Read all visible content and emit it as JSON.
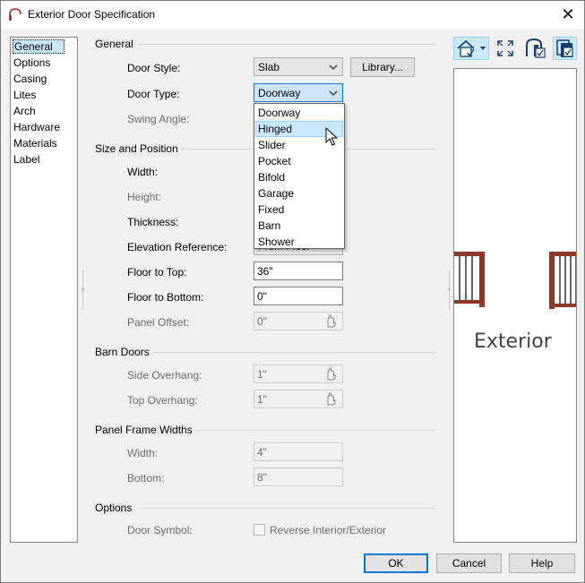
{
  "window": {
    "title": "Exterior Door Specification",
    "close_glyph": "✕"
  },
  "sidebar": {
    "items": [
      {
        "label": "General",
        "selected": true
      },
      {
        "label": "Options"
      },
      {
        "label": "Casing"
      },
      {
        "label": "Lites"
      },
      {
        "label": "Arch"
      },
      {
        "label": "Hardware"
      },
      {
        "label": "Materials"
      },
      {
        "label": "Label"
      }
    ]
  },
  "general": {
    "heading": "General",
    "door_style": {
      "label": "Door Style:",
      "value": "Slab"
    },
    "library_button": "Library...",
    "door_type": {
      "label": "Door Type:",
      "value": "Doorway"
    },
    "swing_angle": {
      "label": "Swing Angle:"
    }
  },
  "size_position": {
    "heading": "Size and Position",
    "width": {
      "label": "Width:"
    },
    "height": {
      "label": "Height:"
    },
    "thickness": {
      "label": "Thickness:"
    },
    "elevation_reference": {
      "label": "Elevation Reference:",
      "value": "From Floor"
    },
    "floor_to_top": {
      "label": "Floor to Top:",
      "value": "36\""
    },
    "floor_to_bottom": {
      "label": "Floor to Bottom:",
      "value": "0\""
    },
    "panel_offset": {
      "label": "Panel Offset:",
      "value": "0\""
    }
  },
  "barn_doors": {
    "heading": "Barn Doors",
    "side_overhang": {
      "label": "Side Overhang:",
      "value": "1\""
    },
    "top_overhang": {
      "label": "Top Overhang:",
      "value": "1\""
    }
  },
  "panel_frame": {
    "heading": "Panel Frame Widths",
    "width": {
      "label": "Width:",
      "value": "4\""
    },
    "bottom": {
      "label": "Bottom:",
      "value": "8\""
    }
  },
  "options": {
    "heading": "Options",
    "door_symbol": {
      "label": "Door Symbol:"
    },
    "reverse_checkbox": {
      "label": "Reverse Interior/Exterior",
      "checked": false
    }
  },
  "door_type_dropdown": {
    "options": [
      "Doorway",
      "Hinged",
      "Slider",
      "Pocket",
      "Bifold",
      "Garage",
      "Fixed",
      "Barn",
      "Shower"
    ],
    "hovered": "Hinged"
  },
  "preview": {
    "caption": "Exterior",
    "toolbar": [
      "view-mode-icon",
      "fill-window-icon",
      "show-3d-icon",
      "show-backdrop-icon"
    ]
  },
  "footer": {
    "ok": "OK",
    "cancel": "Cancel",
    "help": "Help"
  },
  "colors": {
    "accent": "#0078d7",
    "hover": "#cce8ff",
    "railing": "#8b3a2a"
  }
}
